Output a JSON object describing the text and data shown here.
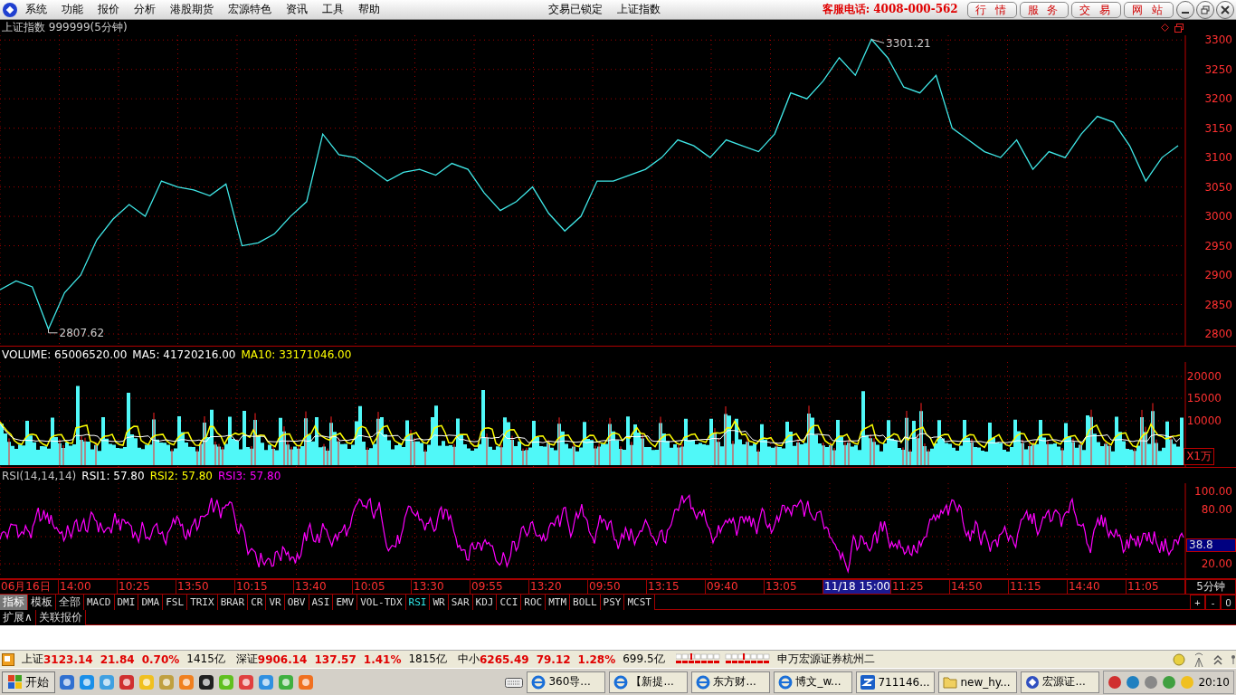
{
  "menu_bar": {
    "items": [
      "系统",
      "功能",
      "报价",
      "分析",
      "港股期货",
      "宏源特色",
      "资讯",
      "工具",
      "帮助"
    ],
    "lock_status": "交易已锁定",
    "current_security": "上证指数",
    "hotline": "客服电话: 4008-000-562",
    "buttons": [
      "行 情",
      "服 务",
      "交 易",
      "网 站"
    ]
  },
  "price_panel": {
    "title": "上证指数 999999(5分钟)",
    "high_label": "3301.21",
    "low_label": "2807.62",
    "chart_data": {
      "type": "line",
      "grid": true,
      "ylim": [
        2780,
        3308
      ],
      "yticks": [
        2800,
        2850,
        2900,
        2950,
        3000,
        3050,
        3100,
        3150,
        3200,
        3250,
        3300
      ],
      "values": [
        2875,
        2890,
        2880,
        2808,
        2870,
        2900,
        2960,
        2995,
        3020,
        3000,
        3060,
        3050,
        3045,
        3035,
        3055,
        2950,
        2955,
        2970,
        3000,
        3025,
        3140,
        3105,
        3100,
        3080,
        3060,
        3075,
        3080,
        3070,
        3090,
        3080,
        3040,
        3010,
        3025,
        3050,
        3005,
        2975,
        3000,
        3060,
        3060,
        3070,
        3080,
        3100,
        3130,
        3120,
        3100,
        3130,
        3120,
        3110,
        3140,
        3210,
        3200,
        3230,
        3270,
        3240,
        3301,
        3270,
        3220,
        3210,
        3240,
        3150,
        3130,
        3110,
        3100,
        3130,
        3080,
        3110,
        3100,
        3140,
        3170,
        3160,
        3120,
        3060,
        3100,
        3120
      ]
    }
  },
  "volume_panel": {
    "legend": [
      {
        "text": "VOLUME: 65006520.00",
        "color": "#ffffff"
      },
      {
        "text": "MA5: 41720216.00",
        "color": "#ffffff"
      },
      {
        "text": "MA10: 33171046.00",
        "color": "#ffff00"
      }
    ],
    "yticks": [
      "20000",
      "15000",
      "10000"
    ],
    "unit": "X1万"
  },
  "rsi_panel": {
    "legend": [
      {
        "text": "RSI(14,14,14)",
        "color": "#c0c0c0"
      },
      {
        "text": "RSI1: 57.80",
        "color": "#ffffff"
      },
      {
        "text": "RSI2: 57.80",
        "color": "#ffff00"
      },
      {
        "text": "RSI3: 57.80",
        "color": "#ff00ff"
      }
    ],
    "yticks": [
      "100.00",
      "80.00",
      "20.00"
    ],
    "current": "38.8"
  },
  "time_axis": {
    "labels": [
      {
        "text": "06月16日",
        "selected": false
      },
      {
        "text": "14:00",
        "selected": false
      },
      {
        "text": "10:25",
        "selected": false
      },
      {
        "text": "13:50",
        "selected": false
      },
      {
        "text": "10:15",
        "selected": false
      },
      {
        "text": "13:40",
        "selected": false
      },
      {
        "text": "10:05",
        "selected": false
      },
      {
        "text": "13:30",
        "selected": false
      },
      {
        "text": "09:55",
        "selected": false
      },
      {
        "text": "13:20",
        "selected": false
      },
      {
        "text": "09:50",
        "selected": false
      },
      {
        "text": "13:15",
        "selected": false
      },
      {
        "text": "09:40",
        "selected": false
      },
      {
        "text": "13:05",
        "selected": false
      },
      {
        "text": "11/18 15:00",
        "selected": true
      },
      {
        "text": "11:25",
        "selected": false
      },
      {
        "text": "14:50",
        "selected": false
      },
      {
        "text": "11:15",
        "selected": false
      },
      {
        "text": "14:40",
        "selected": false
      },
      {
        "text": "11:05",
        "selected": false
      }
    ],
    "period": "5分钟"
  },
  "indicator_tabs": {
    "items": [
      {
        "label": "指标",
        "kind": "mode",
        "selected": true
      },
      {
        "label": "模板",
        "kind": "mode",
        "selected": false
      },
      {
        "label": "全部",
        "kind": "mode",
        "selected": false
      },
      {
        "label": "MACD",
        "kind": "indicator",
        "selected": false
      },
      {
        "label": "DMI",
        "kind": "indicator",
        "selected": false
      },
      {
        "label": "DMA",
        "kind": "indicator",
        "selected": false
      },
      {
        "label": "FSL",
        "kind": "indicator",
        "selected": false
      },
      {
        "label": "TRIX",
        "kind": "indicator",
        "selected": false
      },
      {
        "label": "BRAR",
        "kind": "indicator",
        "selected": false
      },
      {
        "label": "CR",
        "kind": "indicator",
        "selected": false
      },
      {
        "label": "VR",
        "kind": "indicator",
        "selected": false
      },
      {
        "label": "OBV",
        "kind": "indicator",
        "selected": false
      },
      {
        "label": "ASI",
        "kind": "indicator",
        "selected": false
      },
      {
        "label": "EMV",
        "kind": "indicator",
        "selected": false
      },
      {
        "label": "VOL-TDX",
        "kind": "indicator",
        "selected": false
      },
      {
        "label": "RSI",
        "kind": "indicator",
        "selected": true
      },
      {
        "label": "WR",
        "kind": "indicator",
        "selected": false
      },
      {
        "label": "SAR",
        "kind": "indicator",
        "selected": false
      },
      {
        "label": "KDJ",
        "kind": "indicator",
        "selected": false
      },
      {
        "label": "CCI",
        "kind": "indicator",
        "selected": false
      },
      {
        "label": "ROC",
        "kind": "indicator",
        "selected": false
      },
      {
        "label": "MTM",
        "kind": "indicator",
        "selected": false
      },
      {
        "label": "BOLL",
        "kind": "indicator",
        "selected": false
      },
      {
        "label": "PSY",
        "kind": "indicator",
        "selected": false
      },
      {
        "label": "MCST",
        "kind": "indicator",
        "selected": false
      }
    ],
    "zoom_buttons": [
      "+",
      "-",
      "0"
    ]
  },
  "sub_tabs": [
    "扩展∧",
    "关联报价"
  ],
  "status_bar": {
    "indices": [
      {
        "name": "上证",
        "value": "3123.14",
        "change": "21.84",
        "percent": "0.70%",
        "turnover": "1415亿"
      },
      {
        "name": "深证",
        "value": "9906.14",
        "change": "137.57",
        "percent": "1.41%",
        "turnover": "1815亿"
      },
      {
        "name": "中小",
        "value": "6265.49",
        "change": "79.12",
        "percent": "1.28%",
        "turnover": "699.5亿"
      }
    ],
    "broker": "申万宏源证券杭州二"
  },
  "taskbar": {
    "start": "开始",
    "tasks": [
      {
        "label": "360导...",
        "kind": "browser"
      },
      {
        "label": "【新提...",
        "kind": "browser"
      },
      {
        "label": "东方财...",
        "kind": "browser"
      },
      {
        "label": "博文_w...",
        "kind": "browser"
      },
      {
        "label": "711146...",
        "kind": "app"
      },
      {
        "label": "new_hy...",
        "kind": "folder"
      },
      {
        "label": "宏源证...",
        "kind": "trading"
      }
    ],
    "clock": "20:10"
  }
}
